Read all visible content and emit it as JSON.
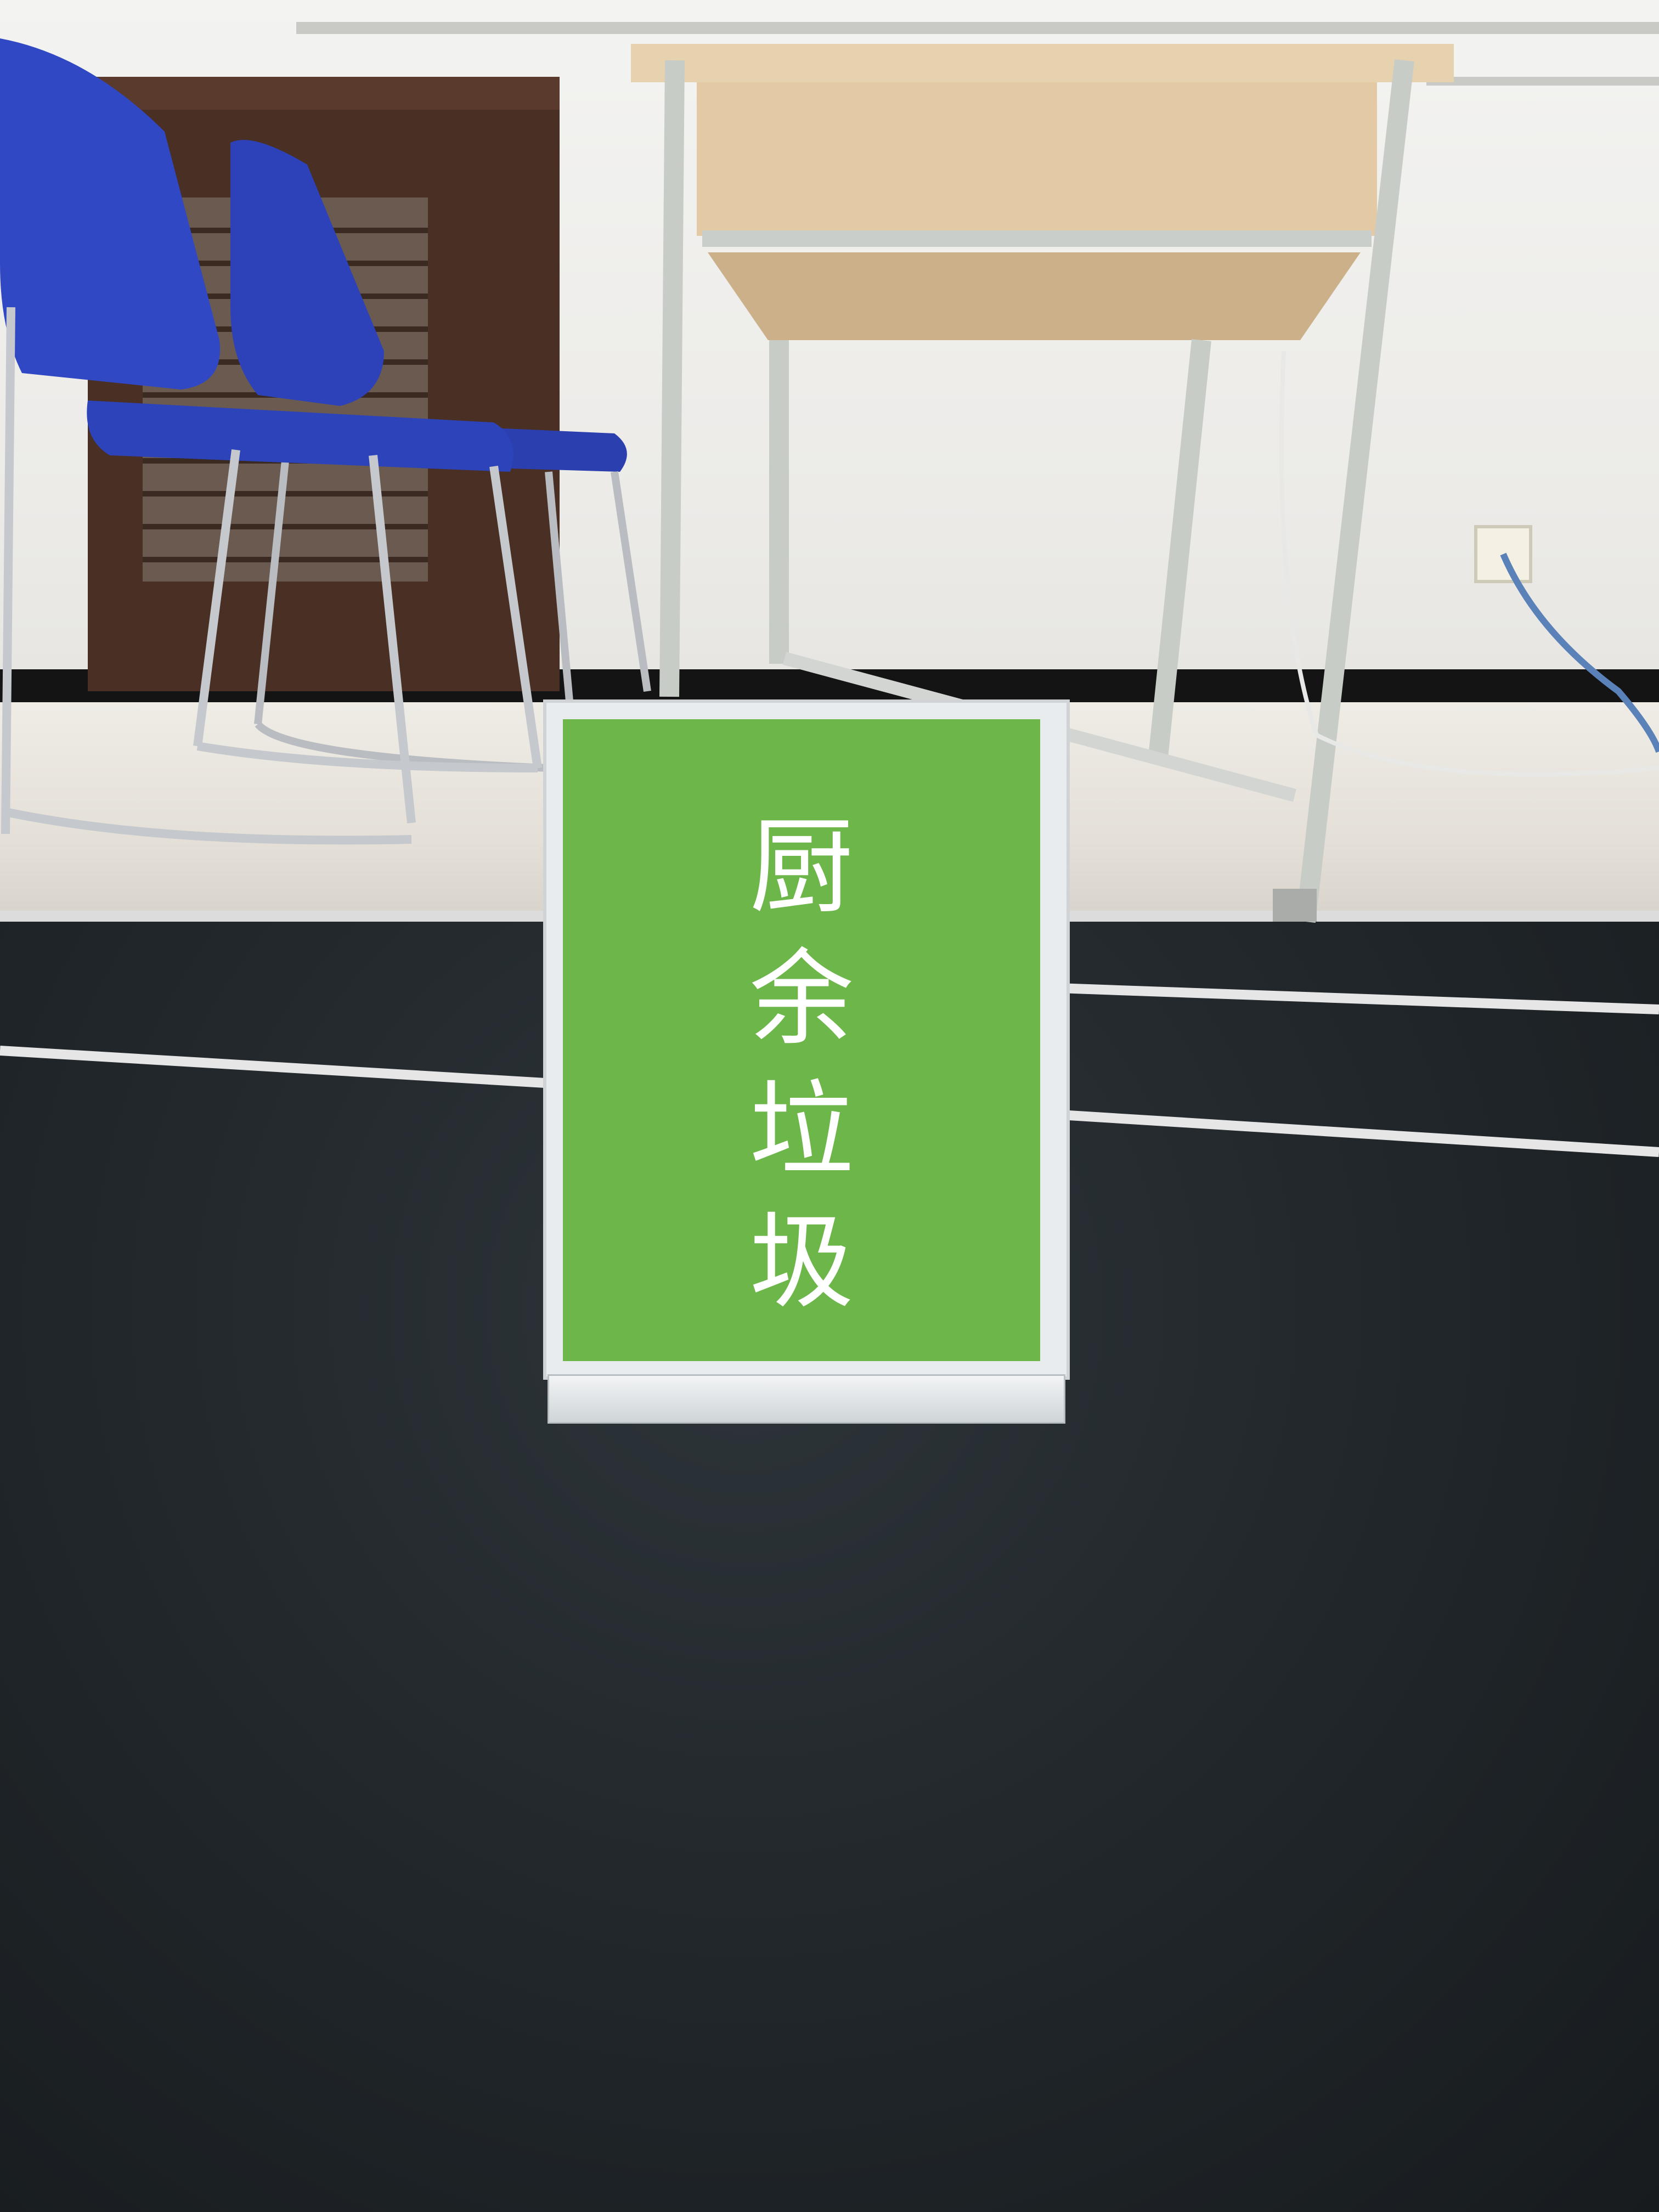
{
  "sign": {
    "chars": [
      "厨",
      "余",
      "垃",
      "圾"
    ],
    "panel_color": "#6db64a",
    "text_color": "#ffffff"
  },
  "scene": {
    "chair_color": "#2f45c0",
    "floor_mat_color": "#22282c",
    "wall_color": "#f3f3f1"
  }
}
